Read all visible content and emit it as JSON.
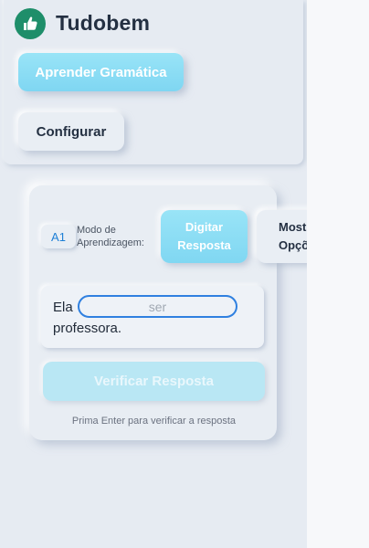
{
  "app": {
    "title": "Tudobem",
    "logo_icon": "thumbs-up-icon",
    "logo_color": "#1e8e6a"
  },
  "sidebar": {
    "learn_grammar_label": "Aprender Gramática",
    "configure_label": "Configurar"
  },
  "exercise": {
    "level": "A1",
    "mode_label": "Modo de Aprendizagem:",
    "mode_type_label": "Digitar Resposta",
    "mode_options_label": "Mostrar Opções",
    "sentence_before": "Ela",
    "input_placeholder": "ser",
    "sentence_after": "professora.",
    "verify_label": "Verificar Resposta",
    "hint": "Prima Enter para verificar a resposta"
  },
  "colors": {
    "accent": "#80d7f2",
    "input_border": "#2f80e0",
    "panel": "#e6ebf2"
  }
}
